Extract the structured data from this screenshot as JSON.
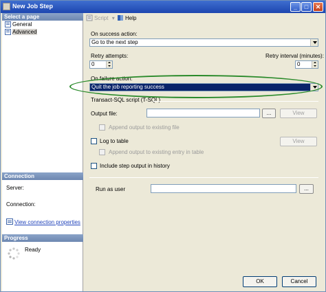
{
  "window": {
    "title": "New Job Step",
    "minimize_glyph": "_",
    "maximize_glyph": "□",
    "close_glyph": "✕"
  },
  "left_pane": {
    "select_page_header": "Select a page",
    "pages": [
      {
        "label": "General",
        "icon": "page-icon",
        "selected": false
      },
      {
        "label": "Advanced",
        "icon": "page-icon",
        "selected": true
      }
    ],
    "connection_header": "Connection",
    "server_label": "Server:",
    "connection_label": "Connection:",
    "view_connection_link": "View connection properties",
    "progress_header": "Progress",
    "progress_status": "Ready"
  },
  "toolbar": {
    "script_label": "Script",
    "help_label": "Help"
  },
  "form": {
    "on_success_label": "On success action:",
    "on_success_value": "Go to the next step",
    "retry_attempts_label": "Retry attempts:",
    "retry_attempts_value": "0",
    "retry_interval_label": "Retry interval (minutes):",
    "retry_interval_value": "0",
    "on_failure_label": "On failure action:",
    "on_failure_value": "Quit the job reporting success",
    "tsql_header": "Transact-SQL script (T-SQL)",
    "output_file_label": "Output file:",
    "browse_label": "...",
    "view_label": "View",
    "append_output_label": "Append output to existing file",
    "log_to_table_label": "Log to table",
    "append_entry_label": "Append output to existing entry in table",
    "include_history_label": "Include step output in history",
    "run_as_label": "Run as user"
  },
  "footer": {
    "ok_label": "OK",
    "cancel_label": "Cancel"
  },
  "colors": {
    "title_bar": "#1d46b0",
    "selection": "#0a246a",
    "highlight_ellipse": "#2a8a2a",
    "link": "#2244bb"
  }
}
